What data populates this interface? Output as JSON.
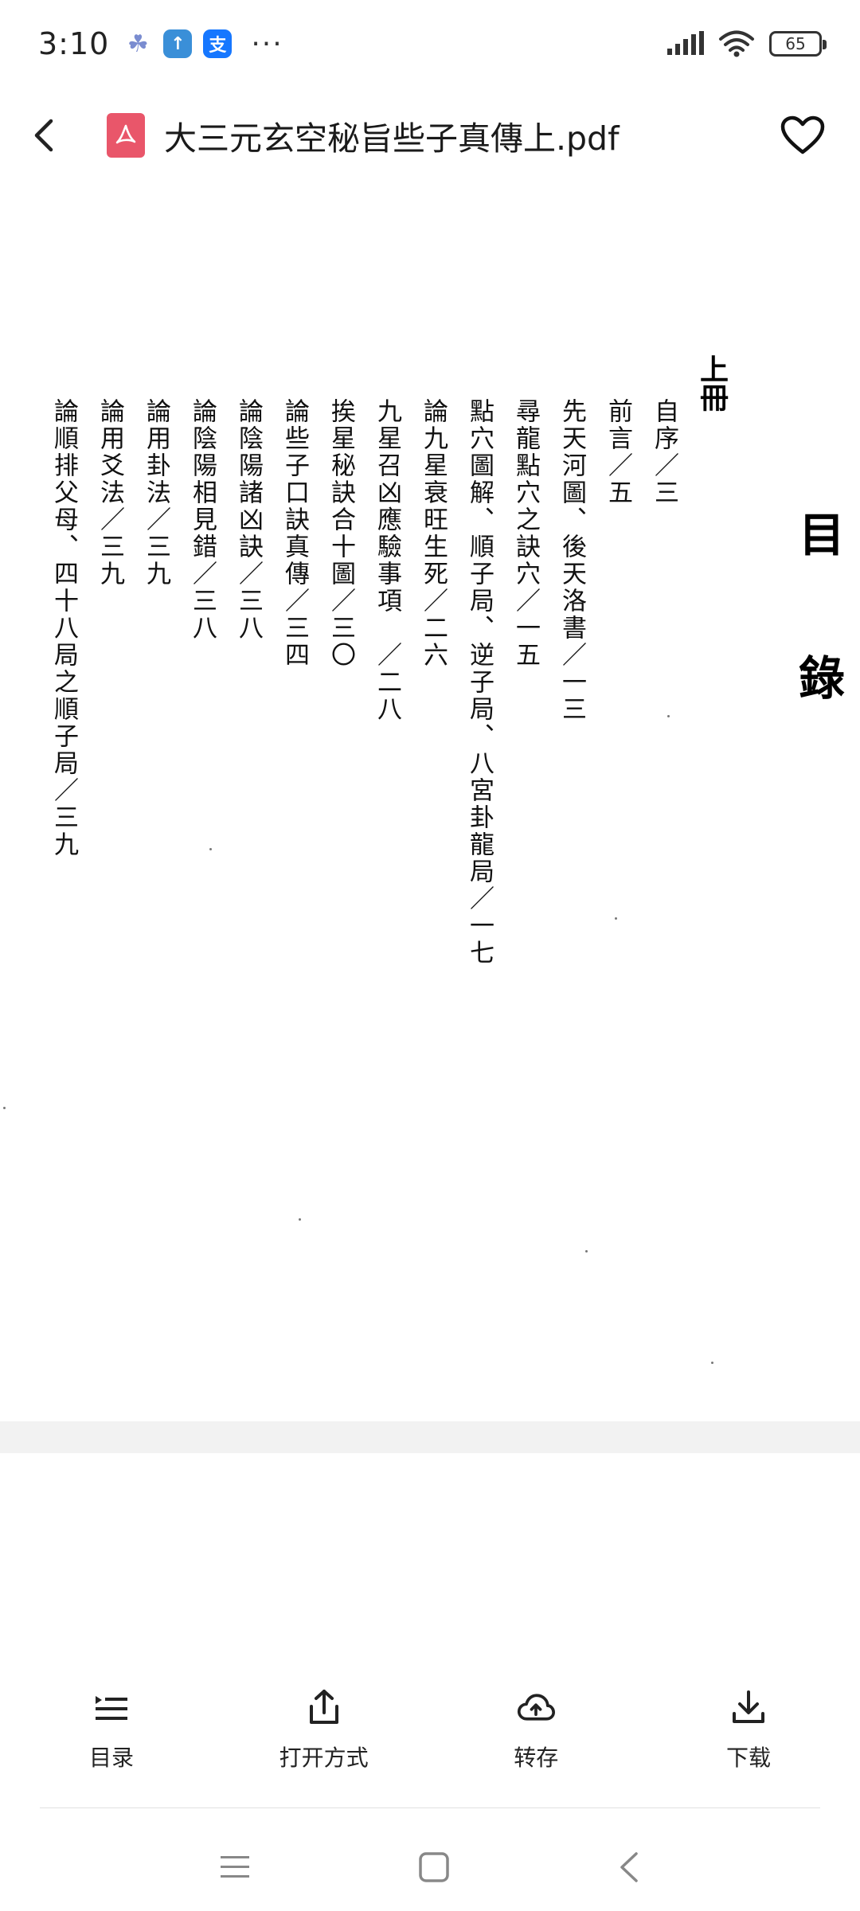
{
  "status_bar": {
    "time": "3:10",
    "apps": [
      {
        "name": "cluster-app-icon",
        "glyph": "☘",
        "color": "#7a8cd0"
      },
      {
        "name": "upload-app-icon",
        "glyph": "↑",
        "color": "#3a8fd8"
      },
      {
        "name": "alipay-app-icon",
        "glyph": "支",
        "color": "#1677ff"
      }
    ],
    "more": "···",
    "battery": "65"
  },
  "title_bar": {
    "title": "大三元玄空秘旨些子真傳上.pdf",
    "icons": {
      "back": "chevron-left-icon",
      "file": "pdf-file-icon",
      "favorite": "heart-icon"
    },
    "accent": "#e9566a"
  },
  "page": {
    "heading": [
      "目",
      "錄"
    ],
    "volume": "上冊",
    "toc": [
      "自序／三",
      "前言／五",
      "先天河圖、後天洛書／一三",
      "尋龍點穴之訣穴／一五",
      "點穴圖解、順子局、逆子局、八宮卦龍局／一七",
      "論九星衰旺生死／二六",
      "九星召凶應驗事項　／二八",
      "挨星秘訣合十圖／三〇",
      "論些子口訣真傳／三四",
      "論陰陽諸凶訣／三八",
      "論陰陽相見錯／三八",
      "論用卦法／三九",
      "論用爻法／三九",
      "論順排父母、四十八局之順子局／三九"
    ]
  },
  "toolbar": {
    "items": [
      {
        "label": "目录",
        "icon": "list-icon"
      },
      {
        "label": "打开方式",
        "icon": "share-icon"
      },
      {
        "label": "转存",
        "icon": "cloud-upload-icon"
      },
      {
        "label": "下载",
        "icon": "download-icon"
      }
    ]
  },
  "nav_bar": {
    "icons": [
      "menu-icon",
      "home-square-icon",
      "back-triangle-icon"
    ]
  }
}
